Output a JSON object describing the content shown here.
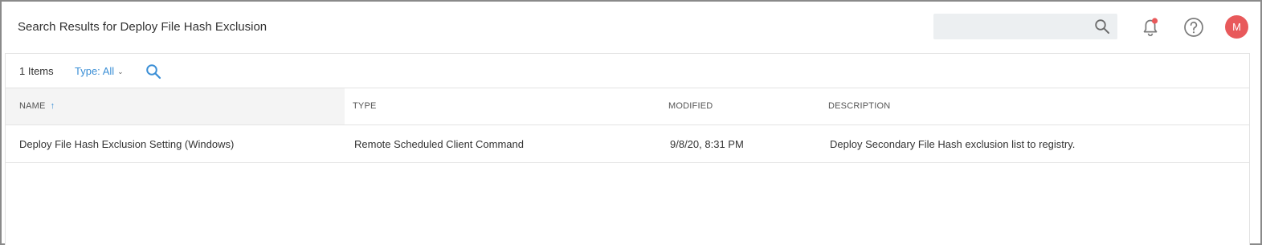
{
  "header": {
    "title": "Search Results for Deploy File Hash Exclusion",
    "search": {
      "value": "",
      "placeholder": ""
    },
    "icons": {
      "search": "search-icon",
      "notifications": "bell-icon",
      "help": "help-icon"
    },
    "notification_dot_color": "#e8595b",
    "avatar_initial": "M",
    "avatar_color": "#e8595b"
  },
  "toolbar": {
    "items_count": "1 Items",
    "type_filter": "Type: All"
  },
  "table": {
    "columns": [
      "NAME",
      "TYPE",
      "MODIFIED",
      "DESCRIPTION"
    ],
    "sort": {
      "column": "NAME",
      "direction": "ascending",
      "arrow": "↑"
    },
    "rows": [
      {
        "name": "Deploy File Hash Exclusion Setting (Windows)",
        "type": "Remote Scheduled Client Command",
        "modified": "9/8/20, 8:31 PM",
        "description": "Deploy Secondary File Hash exclusion list to registry."
      }
    ]
  },
  "colors": {
    "accent": "#3b8fd6",
    "border": "#e3e3e3"
  }
}
